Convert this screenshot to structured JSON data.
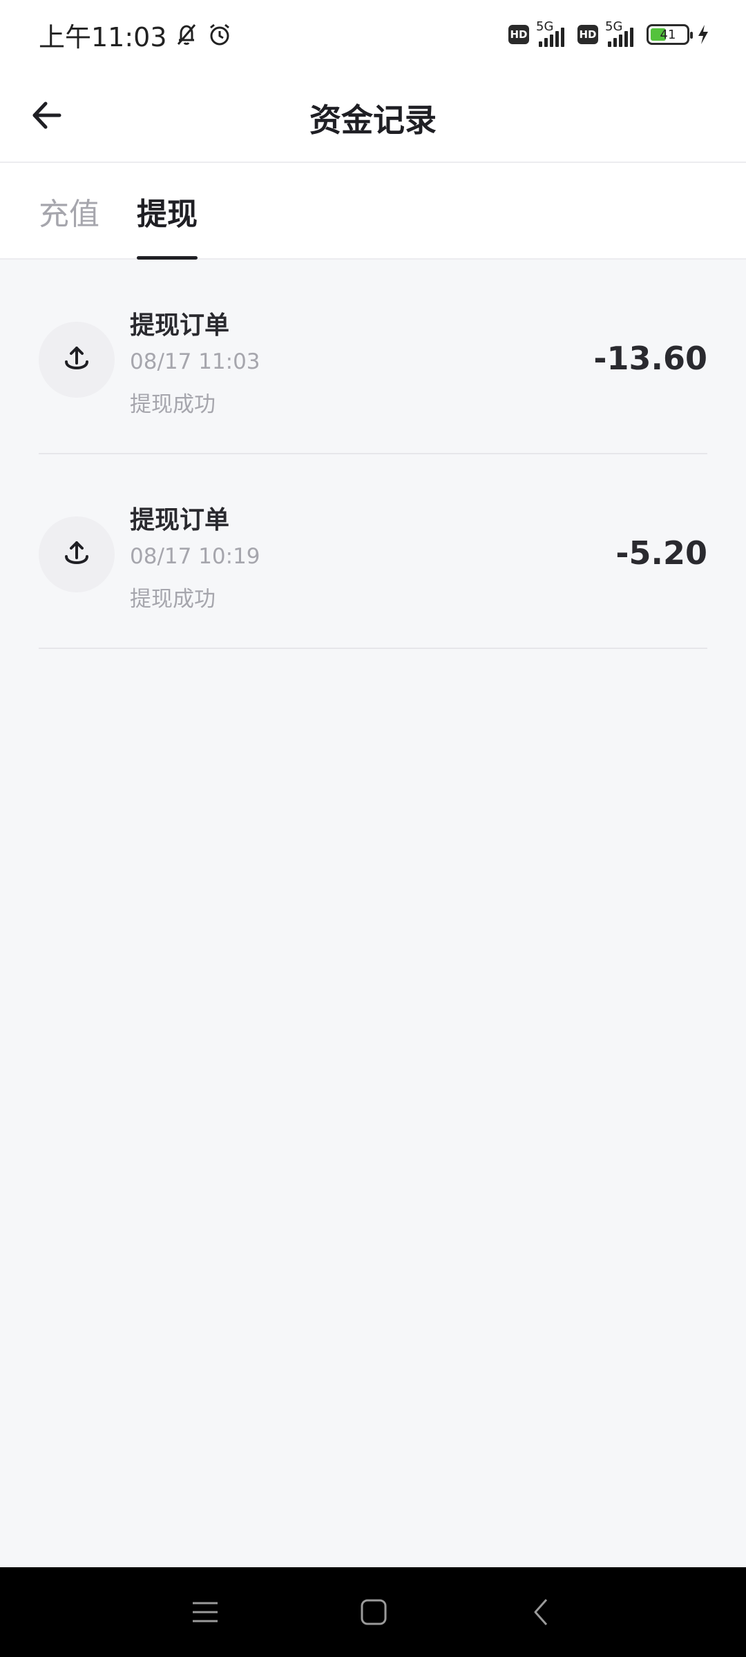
{
  "status_bar": {
    "time": "上午11:03",
    "icons": [
      "bell-off-icon",
      "alarm-icon"
    ],
    "hd_label": "HD",
    "network_label": "5G",
    "battery_level": "41"
  },
  "header": {
    "title": "资金记录",
    "back_icon": "arrow-left-icon"
  },
  "tabs": [
    {
      "label": "充值",
      "active": false
    },
    {
      "label": "提现",
      "active": true
    }
  ],
  "records": [
    {
      "title": "提现订单",
      "time": "08/17 11:03",
      "status": "提现成功",
      "amount": "-13.60",
      "icon": "upload-icon"
    },
    {
      "title": "提现订单",
      "time": "08/17 10:19",
      "status": "提现成功",
      "amount": "-5.20",
      "icon": "upload-icon"
    }
  ],
  "nav_bar": {
    "buttons": [
      "menu-icon",
      "home-icon",
      "back-icon"
    ]
  }
}
